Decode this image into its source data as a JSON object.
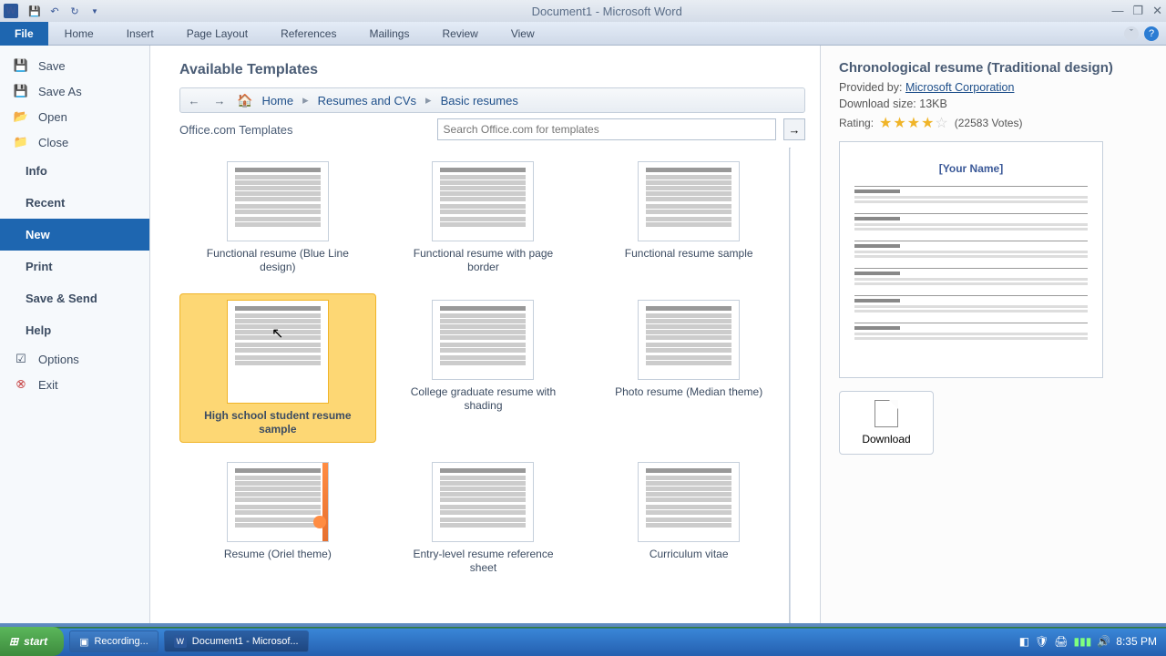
{
  "titlebar": {
    "app_letter": "W",
    "title": "Document1 - Microsoft Word"
  },
  "ribbon": {
    "file": "File",
    "tabs": [
      "Home",
      "Insert",
      "Page Layout",
      "References",
      "Mailings",
      "Review",
      "View"
    ]
  },
  "sidebar": {
    "save": "Save",
    "save_as": "Save As",
    "open": "Open",
    "close": "Close",
    "info": "Info",
    "recent": "Recent",
    "new": "New",
    "print": "Print",
    "save_send": "Save & Send",
    "help": "Help",
    "options": "Options",
    "exit": "Exit"
  },
  "main": {
    "heading": "Available Templates",
    "crumb_home": "Home",
    "crumb_resumes": "Resumes and CVs",
    "crumb_basic": "Basic resumes",
    "search_label": "Office.com Templates",
    "search_placeholder": "Search Office.com for templates",
    "templates": [
      "Functional resume (Blue Line design)",
      "Functional resume with page border",
      "Functional resume sample",
      "High school student resume sample",
      "College graduate resume with shading",
      "Photo resume (Median theme)",
      "Resume (Oriel theme)",
      "Entry-level resume reference sheet",
      "Curriculum vitae"
    ]
  },
  "preview": {
    "title": "Chronological resume (Traditional design)",
    "provided_label": "Provided by:",
    "provided_by": "Microsoft Corporation",
    "size_label": "Download size:",
    "size": "13KB",
    "rating_label": "Rating:",
    "votes": "(22583 Votes)",
    "your_name": "[Your Name]",
    "download": "Download"
  },
  "taskbar": {
    "start": "start",
    "task1": "Recording...",
    "task2": "Document1 - Microsof...",
    "time": "8:35 PM"
  }
}
